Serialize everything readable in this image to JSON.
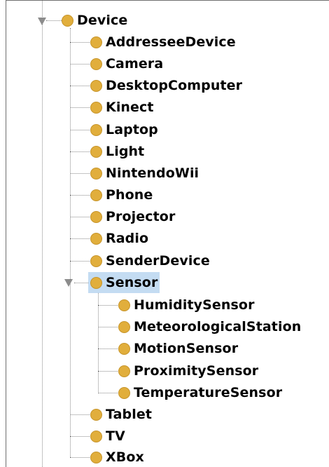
{
  "tree": {
    "root": {
      "label": "Device",
      "children": [
        {
          "label": "AddresseeDevice"
        },
        {
          "label": "Camera"
        },
        {
          "label": "DesktopComputer"
        },
        {
          "label": "Kinect"
        },
        {
          "label": "Laptop"
        },
        {
          "label": "Light"
        },
        {
          "label": "NintendoWii"
        },
        {
          "label": "Phone"
        },
        {
          "label": "Projector"
        },
        {
          "label": "Radio"
        },
        {
          "label": "SenderDevice"
        },
        {
          "label": "Sensor",
          "selected": true,
          "expanded": true,
          "children": [
            {
              "label": "HumiditySensor"
            },
            {
              "label": "MeteorologicalStation"
            },
            {
              "label": "MotionSensor"
            },
            {
              "label": "ProximitySensor"
            },
            {
              "label": "TemperatureSensor"
            }
          ]
        },
        {
          "label": "Tablet"
        },
        {
          "label": "TV"
        },
        {
          "label": "XBox"
        }
      ]
    }
  },
  "colors": {
    "class_dot": "#e1ae3c",
    "selection": "#c4dcf2",
    "connector": "#8a8a8a"
  }
}
